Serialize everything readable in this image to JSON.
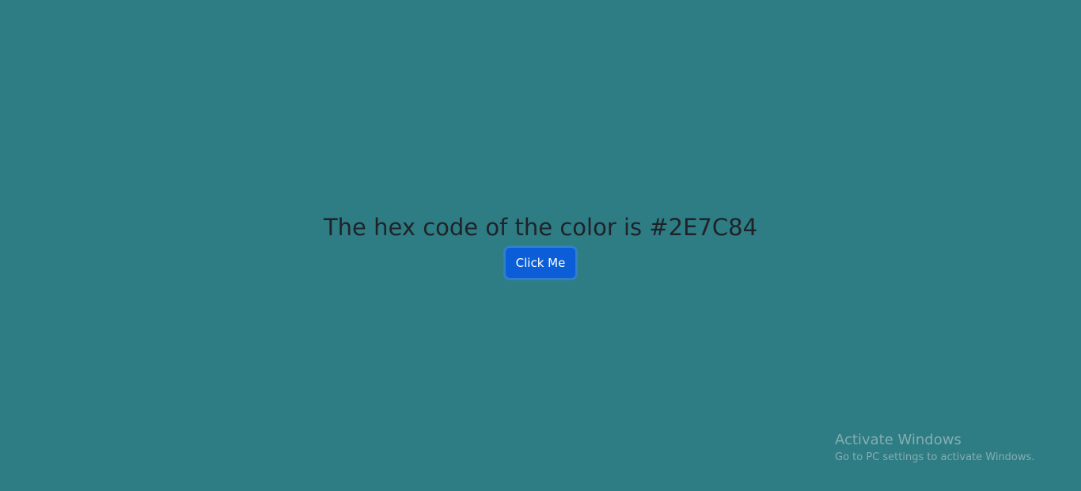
{
  "page": {
    "background_color": "#2E7C84",
    "heading": "The hex code of the color is #2E7C84",
    "button_label": "Click Me"
  },
  "overlay": {
    "activate_title": "Activate Windows",
    "activate_subtitle": "Go to PC settings to activate Windows."
  },
  "colors": {
    "heading_text": "#1F2328",
    "button_background": "#0B5ED7",
    "button_text": "#FFFFFF",
    "watermark_text": "#8FB3B6"
  }
}
